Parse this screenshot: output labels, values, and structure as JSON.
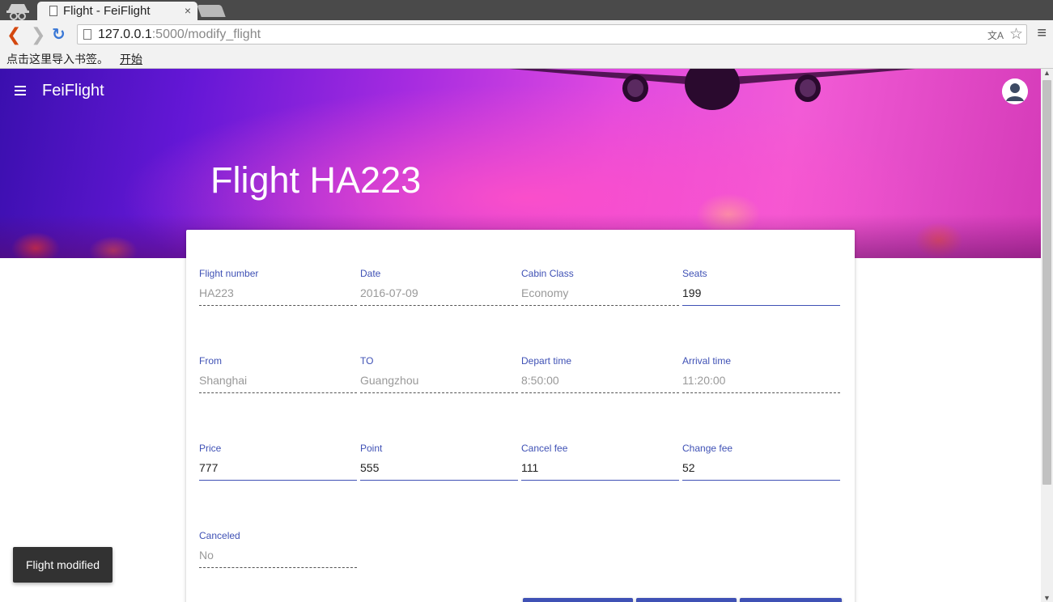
{
  "browser": {
    "tab_title": "Flight - FeiFlight",
    "tab_close": "×",
    "url_host": "127.0.0.1",
    "url_rest": ":5000/modify_flight",
    "bookmarks_hint": "点击这里导入书签。",
    "bookmarks_start": "开始"
  },
  "app": {
    "brand": "FeiFlight",
    "page_title": "Flight HA223"
  },
  "form": {
    "flight_number": {
      "label": "Flight number",
      "value": "HA223"
    },
    "date": {
      "label": "Date",
      "value": "2016-07-09"
    },
    "cabin_class": {
      "label": "Cabin Class",
      "value": "Economy"
    },
    "seats": {
      "label": "Seats",
      "value": "199"
    },
    "from": {
      "label": "From",
      "value": "Shanghai"
    },
    "to": {
      "label": "TO",
      "value": "Guangzhou"
    },
    "depart_time": {
      "label": "Depart time",
      "value": "8:50:00"
    },
    "arrival_time": {
      "label": "Arrival time",
      "value": "11:20:00"
    },
    "price": {
      "label": "Price",
      "value": "777"
    },
    "point": {
      "label": "Point",
      "value": "555"
    },
    "cancel_fee": {
      "label": "Cancel fee",
      "value": "111"
    },
    "change_fee": {
      "label": "Change fee",
      "value": "52"
    },
    "canceled": {
      "label": "Canceled",
      "value": "No"
    }
  },
  "snackbar": {
    "message": "Flight modified"
  },
  "colors": {
    "accent": "#3f51b5",
    "snackbar": "#323232"
  },
  "icons": [
    "incognito-icon",
    "page-icon",
    "back-icon",
    "forward-icon",
    "reload-icon",
    "translate-icon",
    "star-icon",
    "chrome-menu-icon",
    "hamburger-icon",
    "avatar-icon"
  ]
}
